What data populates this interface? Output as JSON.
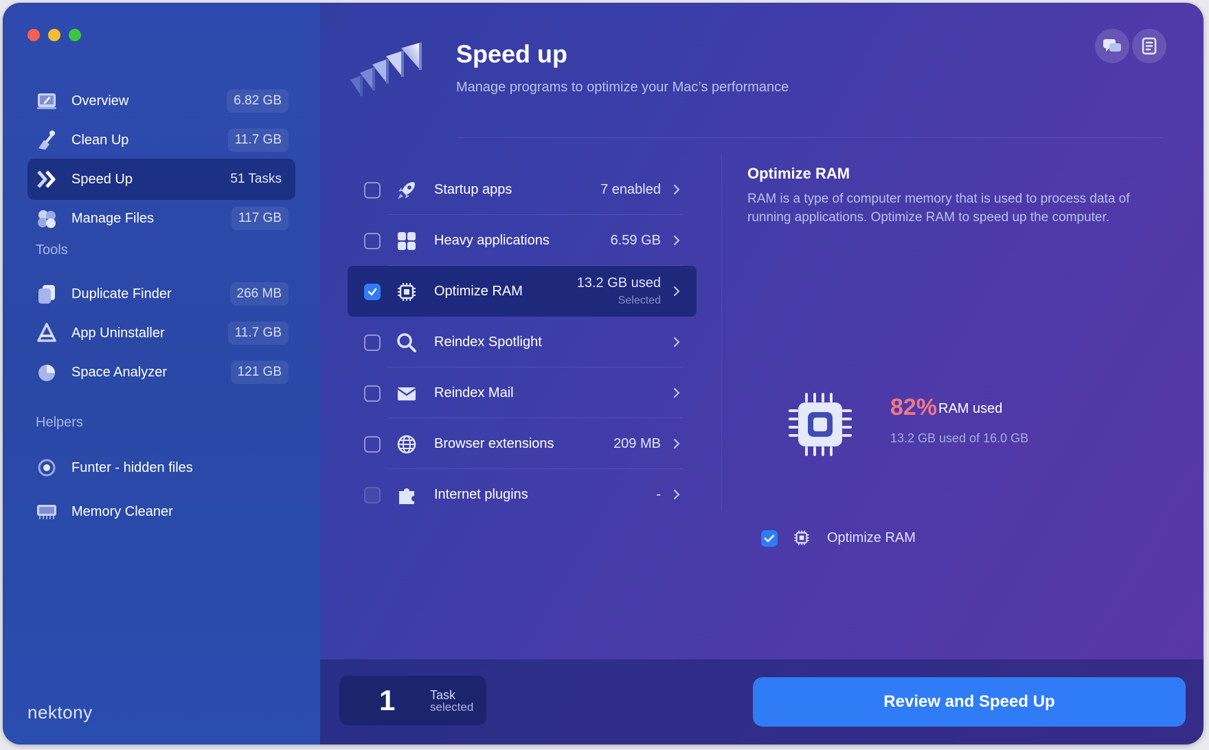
{
  "app": {
    "brand": "nektony"
  },
  "sidebar": {
    "items": [
      {
        "label": "Overview",
        "value": "6.82 GB",
        "icon": "overview-icon"
      },
      {
        "label": "Clean Up",
        "value": "11.7 GB",
        "icon": "broom-icon"
      },
      {
        "label": "Speed Up",
        "value": "51 Tasks",
        "icon": "speed-chevrons-icon",
        "active": true
      },
      {
        "label": "Manage Files",
        "value": "117 GB",
        "icon": "files-icon"
      }
    ],
    "tools_title": "Tools",
    "tools": [
      {
        "label": "Duplicate Finder",
        "value": "266 MB",
        "icon": "duplicate-icon"
      },
      {
        "label": "App Uninstaller",
        "value": "11.7 GB",
        "icon": "uninstaller-icon"
      },
      {
        "label": "Space Analyzer",
        "value": "121 GB",
        "icon": "pie-icon"
      }
    ],
    "helpers_title": "Helpers",
    "helpers": [
      {
        "label": "Funter - hidden files",
        "icon": "eye-icon"
      },
      {
        "label": "Memory Cleaner",
        "icon": "memory-icon"
      }
    ]
  },
  "header": {
    "title": "Speed up",
    "subtitle": "Manage programs to optimize your Mac’s performance"
  },
  "tasks": [
    {
      "label": "Startup apps",
      "value": "7 enabled",
      "checked": false,
      "icon": "rocket-icon"
    },
    {
      "label": "Heavy applications",
      "value": "6.59 GB",
      "checked": false,
      "icon": "grid-icon"
    },
    {
      "label": "Optimize RAM",
      "value": "13.2 GB used",
      "sub": "Selected",
      "checked": true,
      "icon": "chip-icon"
    },
    {
      "label": "Reindex Spotlight",
      "value": "",
      "checked": false,
      "icon": "search-icon"
    },
    {
      "label": "Reindex Mail",
      "value": "",
      "checked": false,
      "icon": "mail-icon"
    },
    {
      "label": "Browser extensions",
      "value": "209 MB",
      "checked": false,
      "icon": "globe-icon"
    },
    {
      "label": "Internet plugins",
      "value": "-",
      "checked": false,
      "disabled": true,
      "icon": "puzzle-icon"
    }
  ],
  "detail": {
    "title": "Optimize RAM",
    "description": "RAM is a type of computer memory that is used to process data of running applications. Optimize RAM to speed up the computer.",
    "ram_percent": "82%",
    "ram_used_label": "RAM used",
    "ram_detail": "13.2 GB used of 16.0 GB",
    "option_label": "Optimize RAM"
  },
  "footer": {
    "count": "1",
    "count_label_1": "Task",
    "count_label_2": "selected",
    "cta": "Review and Speed Up"
  },
  "colors": {
    "accent": "#2f7cf6",
    "warning": "#f27785"
  }
}
